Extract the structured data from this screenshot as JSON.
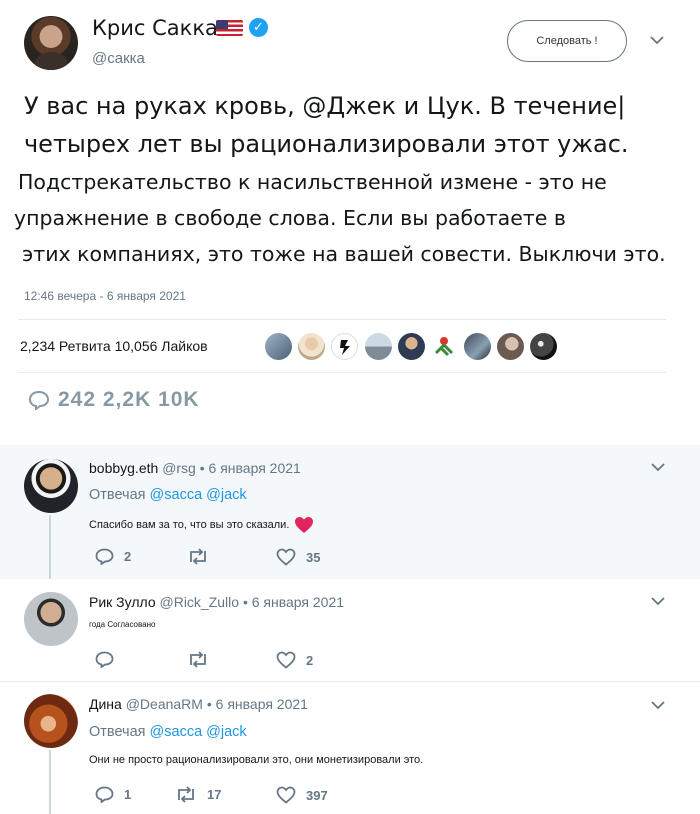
{
  "tweet": {
    "author_name": "Крис Сакка",
    "author_handle": "@сакка",
    "follow_label": "Следовать !",
    "lines": [
      "У вас на руках кровь, @Джек и Цук. В течение|",
      "четырех лет вы рационализировали этот ужас.",
      "Подстрекательство к насильственной измене - это не",
      "упражнение в свободе слова. Если вы работаете в",
      "этих компаниях, это тоже на вашей совести. Выключи это."
    ],
    "timestamp": "12:46 вечера - 6 января 2021",
    "stats": "2,234 Ретвита 10,056 Лайков",
    "action_counts": "242 2,2K 10K"
  },
  "replies": [
    {
      "name": "bobbyg.eth",
      "meta": "@rsg • 6 января 2021",
      "replying_label": "Отвечая",
      "replying_mentions": "@sacca @jack",
      "text": "Спасибо вам за то, что вы это сказали.",
      "reply_count": "2",
      "retweet_count": "",
      "like_count": "35"
    },
    {
      "name": "Рик Зулло",
      "meta": "@Rick_Zullo • 6 января 2021",
      "text": "года Согласовано",
      "reply_count": "",
      "retweet_count": "",
      "like_count": "2"
    },
    {
      "name": "Дина",
      "meta": "@DeanaRM • 6 января 2021",
      "replying_label": "Отвечая",
      "replying_mentions": "@sacca @jack",
      "text": "Они не просто рационализировали это, они монетизировали это.",
      "reply_count": "1",
      "retweet_count": "17",
      "like_count": "397"
    }
  ],
  "colors": {
    "accent": "#1b95e0",
    "muted": "#657786",
    "like_red": "#e0245e",
    "highlight_bg": "#f5f8fa"
  }
}
